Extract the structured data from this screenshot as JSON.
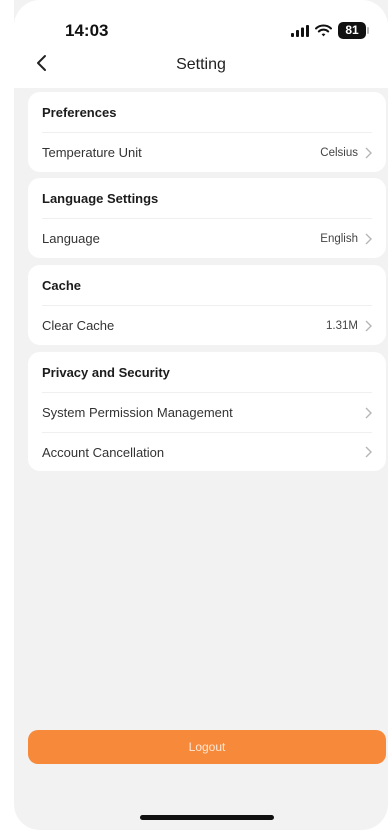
{
  "status_bar": {
    "time": "14:03",
    "battery": "81"
  },
  "header": {
    "title": "Setting"
  },
  "sections": [
    {
      "title": "Preferences",
      "rows": [
        {
          "label": "Temperature Unit",
          "value": "Celsius"
        }
      ]
    },
    {
      "title": "Language Settings",
      "rows": [
        {
          "label": "Language",
          "value": "English"
        }
      ]
    },
    {
      "title": "Cache",
      "rows": [
        {
          "label": "Clear Cache",
          "value": "1.31M"
        }
      ]
    },
    {
      "title": "Privacy and Security",
      "rows": [
        {
          "label": "System Permission Management",
          "value": ""
        },
        {
          "label": "Account Cancellation",
          "value": ""
        }
      ]
    }
  ],
  "logout_label": "Logout",
  "colors": {
    "accent": "#f7893a",
    "background": "#f2f2f2"
  },
  "icons": {
    "back": "chevron-left-icon",
    "row_arrow": "chevron-right-icon"
  }
}
